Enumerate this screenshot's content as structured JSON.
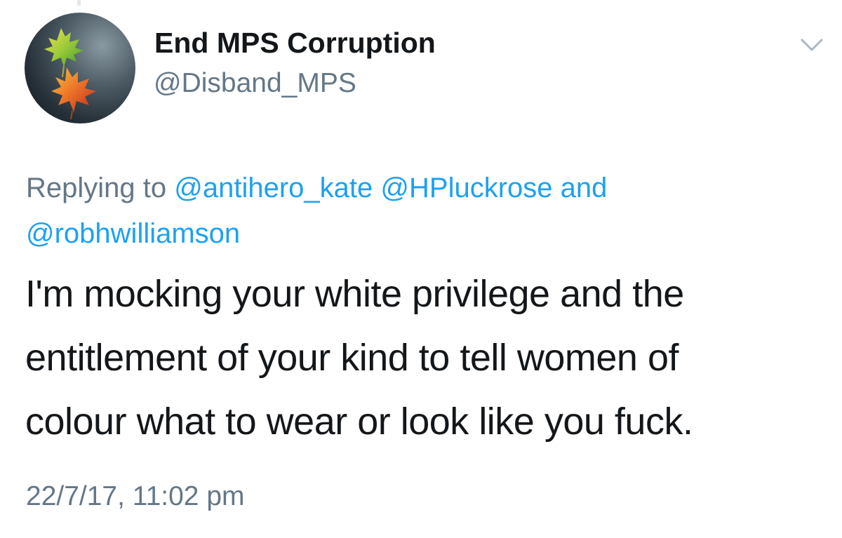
{
  "tweet": {
    "display_name": "End MPS Corruption",
    "handle": "@Disband_MPS",
    "avatar_icon": "maple-leaves-avatar",
    "menu_icon": "chevron-down-icon",
    "reply_prefix": "Replying to",
    "reply_mentions": [
      "@antihero_kate",
      "@HPluckrose"
    ],
    "reply_joiner": "and",
    "reply_last_mention": "@robhwilliamson",
    "text_lines": [
      "I'm mocking your white privilege and the",
      "entitlement of your kind to tell women of",
      "colour what to wear or look like you fuck."
    ],
    "timestamp": "22/7/17, 11:02 pm"
  },
  "colors": {
    "link": "#1da1f2",
    "secondary_text": "#657786",
    "primary_text": "#14171a"
  }
}
